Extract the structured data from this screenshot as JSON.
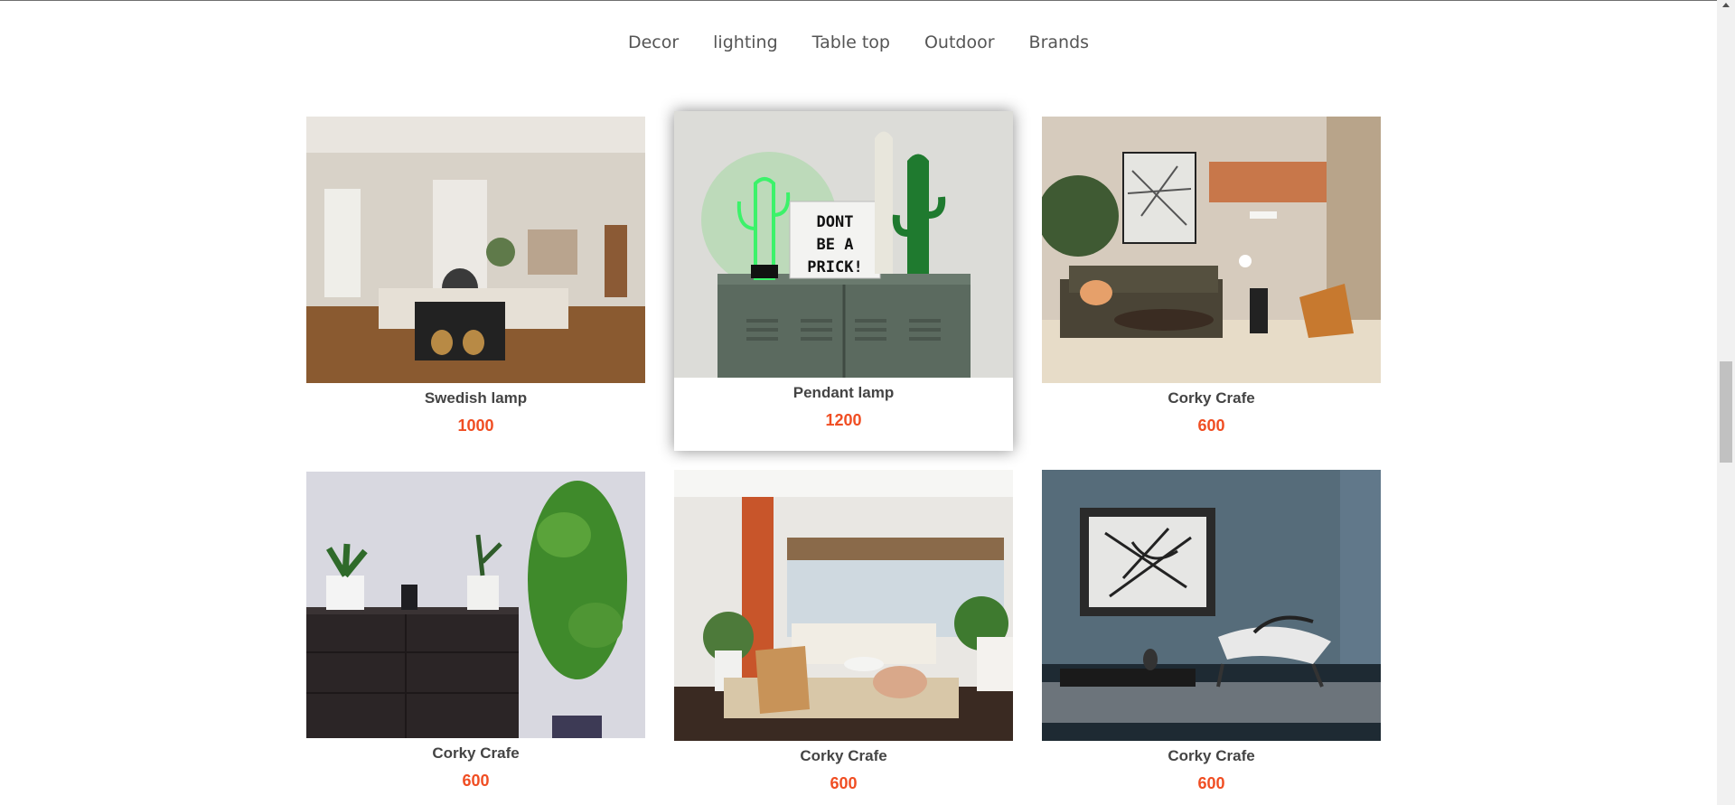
{
  "nav": {
    "categories": [
      "Decor",
      "lighting",
      "Table top",
      "Outdoor",
      "Brands"
    ]
  },
  "products": [
    {
      "name": "Swedish lamp",
      "price": "1000"
    },
    {
      "name": "Pendant lamp",
      "price": "1200"
    },
    {
      "name": "Corky Crafe",
      "price": "600"
    },
    {
      "name": "Corky Crafe",
      "price": "600"
    },
    {
      "name": "Corky Crafe",
      "price": "600"
    },
    {
      "name": "Corky Crafe",
      "price": "600"
    }
  ],
  "lightbox_sign": [
    "DONT",
    "BE A",
    "PRICK!"
  ],
  "colors": {
    "price": "#f04e23",
    "title": "#444444"
  }
}
